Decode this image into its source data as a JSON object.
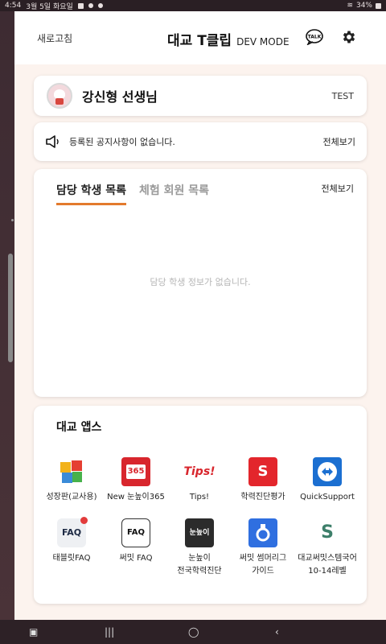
{
  "status": {
    "time": "4:54",
    "date": "3월 5일 화요일",
    "battery": "34%"
  },
  "header": {
    "refresh_label": "새로고침",
    "brand_title": "대교 T클립",
    "brand_mode": "DEV MODE",
    "talk_text": "TALK"
  },
  "profile": {
    "name": "강신형 선생님",
    "badge": "TEST"
  },
  "notice": {
    "text": "등록된 공지사항이 없습니다.",
    "view_all": "전체보기"
  },
  "students": {
    "tabs": [
      {
        "label": "담당 학생 목록",
        "active": true
      },
      {
        "label": "체험 회원 목록",
        "active": false
      }
    ],
    "view_all": "전체보기",
    "empty_message": "담당 학생 정보가 없습니다."
  },
  "apps": {
    "title": "대교 앱스",
    "items": [
      {
        "label": "성장판(교사용)",
        "icon": "puzzle-icon"
      },
      {
        "label": "New 눈높이365",
        "icon": "365-icon",
        "icon_text": "365"
      },
      {
        "label": "Tips!",
        "icon": "tips-icon",
        "icon_text": "Tips!"
      },
      {
        "label": "학력진단평가",
        "icon": "summit-icon",
        "icon_text": "S"
      },
      {
        "label": "QuickSupport",
        "icon": "quicksupport-icon"
      },
      {
        "label": "태블릿FAQ",
        "icon": "tablet-faq-icon",
        "icon_text": "FAQ"
      },
      {
        "label": "써밋 FAQ",
        "icon": "summit-faq-icon",
        "icon_text": "FAQ"
      },
      {
        "label": "눈높이\n전국학력진단",
        "line1": "눈높이",
        "line2": "전국학력진단",
        "icon": "nunnopi-diagnosis-icon",
        "icon_text": "눈높이"
      },
      {
        "label": "써밋 썸머리그\n가이드",
        "line1": "써밋 썸머리그",
        "line2": "가이드",
        "icon": "summer-league-icon"
      },
      {
        "label": "대교써밋스템국어\n10-14레벨",
        "line1": "대교써밋스템국어",
        "line2": "10-14레벨",
        "icon": "stem-korean-icon",
        "icon_text": "S"
      }
    ]
  },
  "colors": {
    "accent": "#e37a2d",
    "background": "#fcf3ee"
  }
}
